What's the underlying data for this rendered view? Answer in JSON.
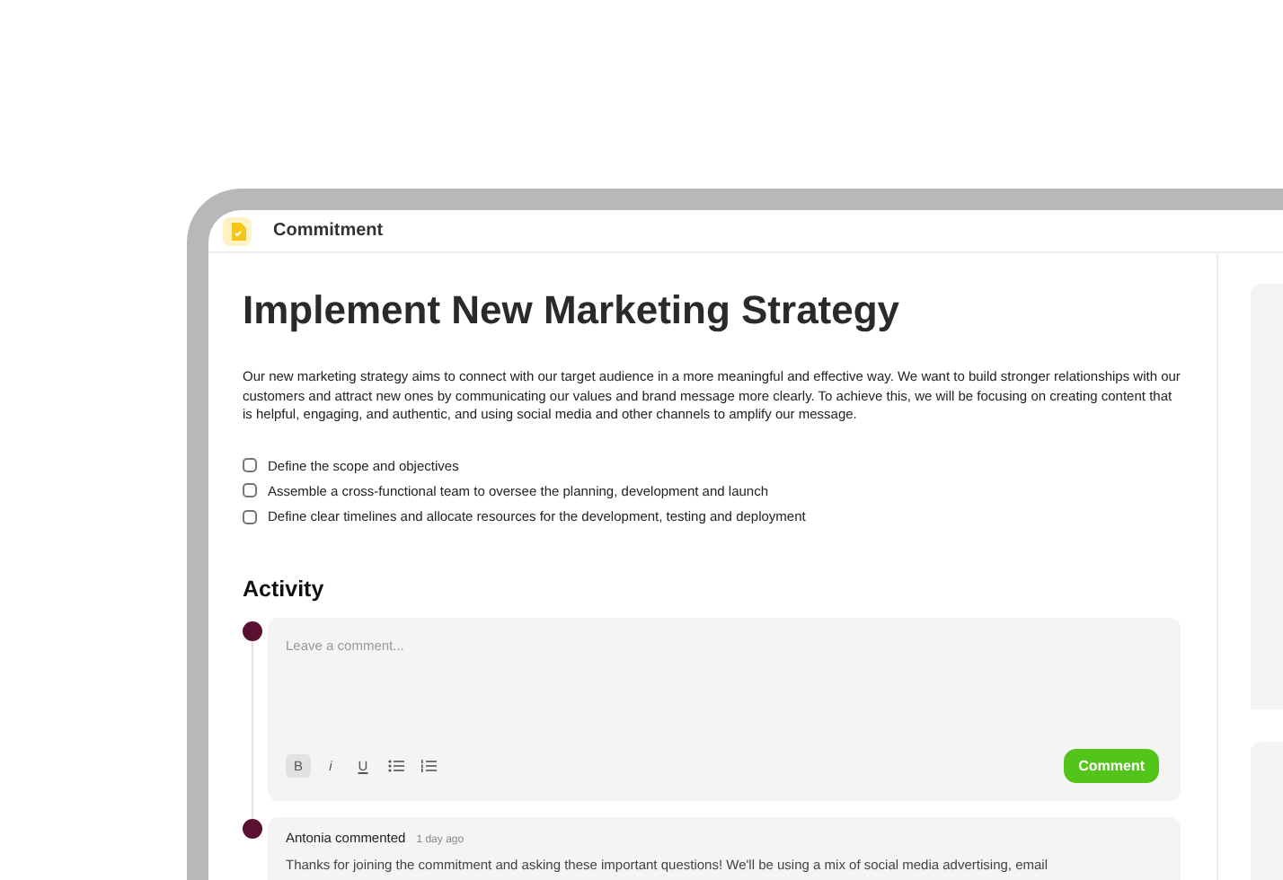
{
  "header": {
    "title": "Commitment"
  },
  "title": "Implement New Marketing Strategy",
  "description": "Our new marketing strategy aims to connect with our target audience in a more meaningful and effective way. We want to build stronger relationships with our customers and attract new ones by communicating our values and brand message more clearly. To achieve this, we will be focusing on creating content that is helpful, engaging, and authentic, and using social media and other channels to amplify our message.",
  "checklist": [
    {
      "label": "Define the scope and objectives",
      "checked": false
    },
    {
      "label": "Assemble a cross-functional team to oversee the planning, development and launch",
      "checked": false
    },
    {
      "label": "Define clear timelines and allocate resources for the development, testing and deployment",
      "checked": false
    }
  ],
  "activity": {
    "heading": "Activity",
    "composer": {
      "placeholder": "Leave a comment...",
      "toolbar": [
        {
          "kind": "bold",
          "label": "B",
          "selected": true
        },
        {
          "kind": "italic",
          "label": "i",
          "selected": false
        },
        {
          "kind": "underline",
          "label": "U",
          "selected": false
        },
        {
          "kind": "bullets",
          "selected": false
        },
        {
          "kind": "numbers",
          "selected": false
        }
      ],
      "submit": "Comment"
    },
    "comments": [
      {
        "author": "Antonia commented",
        "time": "1 day ago",
        "text": "Thanks for joining the commitment and asking these important questions! We'll be using a mix of social media advertising, email"
      }
    ]
  }
}
